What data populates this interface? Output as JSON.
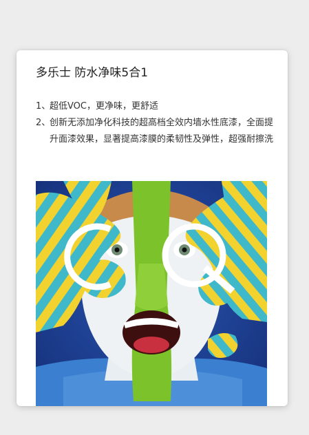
{
  "product": {
    "title": "多乐士 防水净味5合1"
  },
  "features": [
    {
      "number": "1、",
      "text": "超低VOC，更净味，更舒适"
    },
    {
      "number": "2、",
      "text": "创新无添加净化科技的超高档全效内墙水性底漆，全面提升面漆效果，显著提高漆膜的柔韧性及弹性，超强耐擦洗"
    }
  ],
  "image": {
    "logo_letters": "CQ"
  },
  "colors": {
    "background": "#ededed",
    "card": "#ffffff",
    "photo_blue": "#1d3f8f",
    "stripe_cyan": "#3fb8c9",
    "stripe_yellow": "#f2d22e",
    "face_green": "#7cc22a"
  }
}
